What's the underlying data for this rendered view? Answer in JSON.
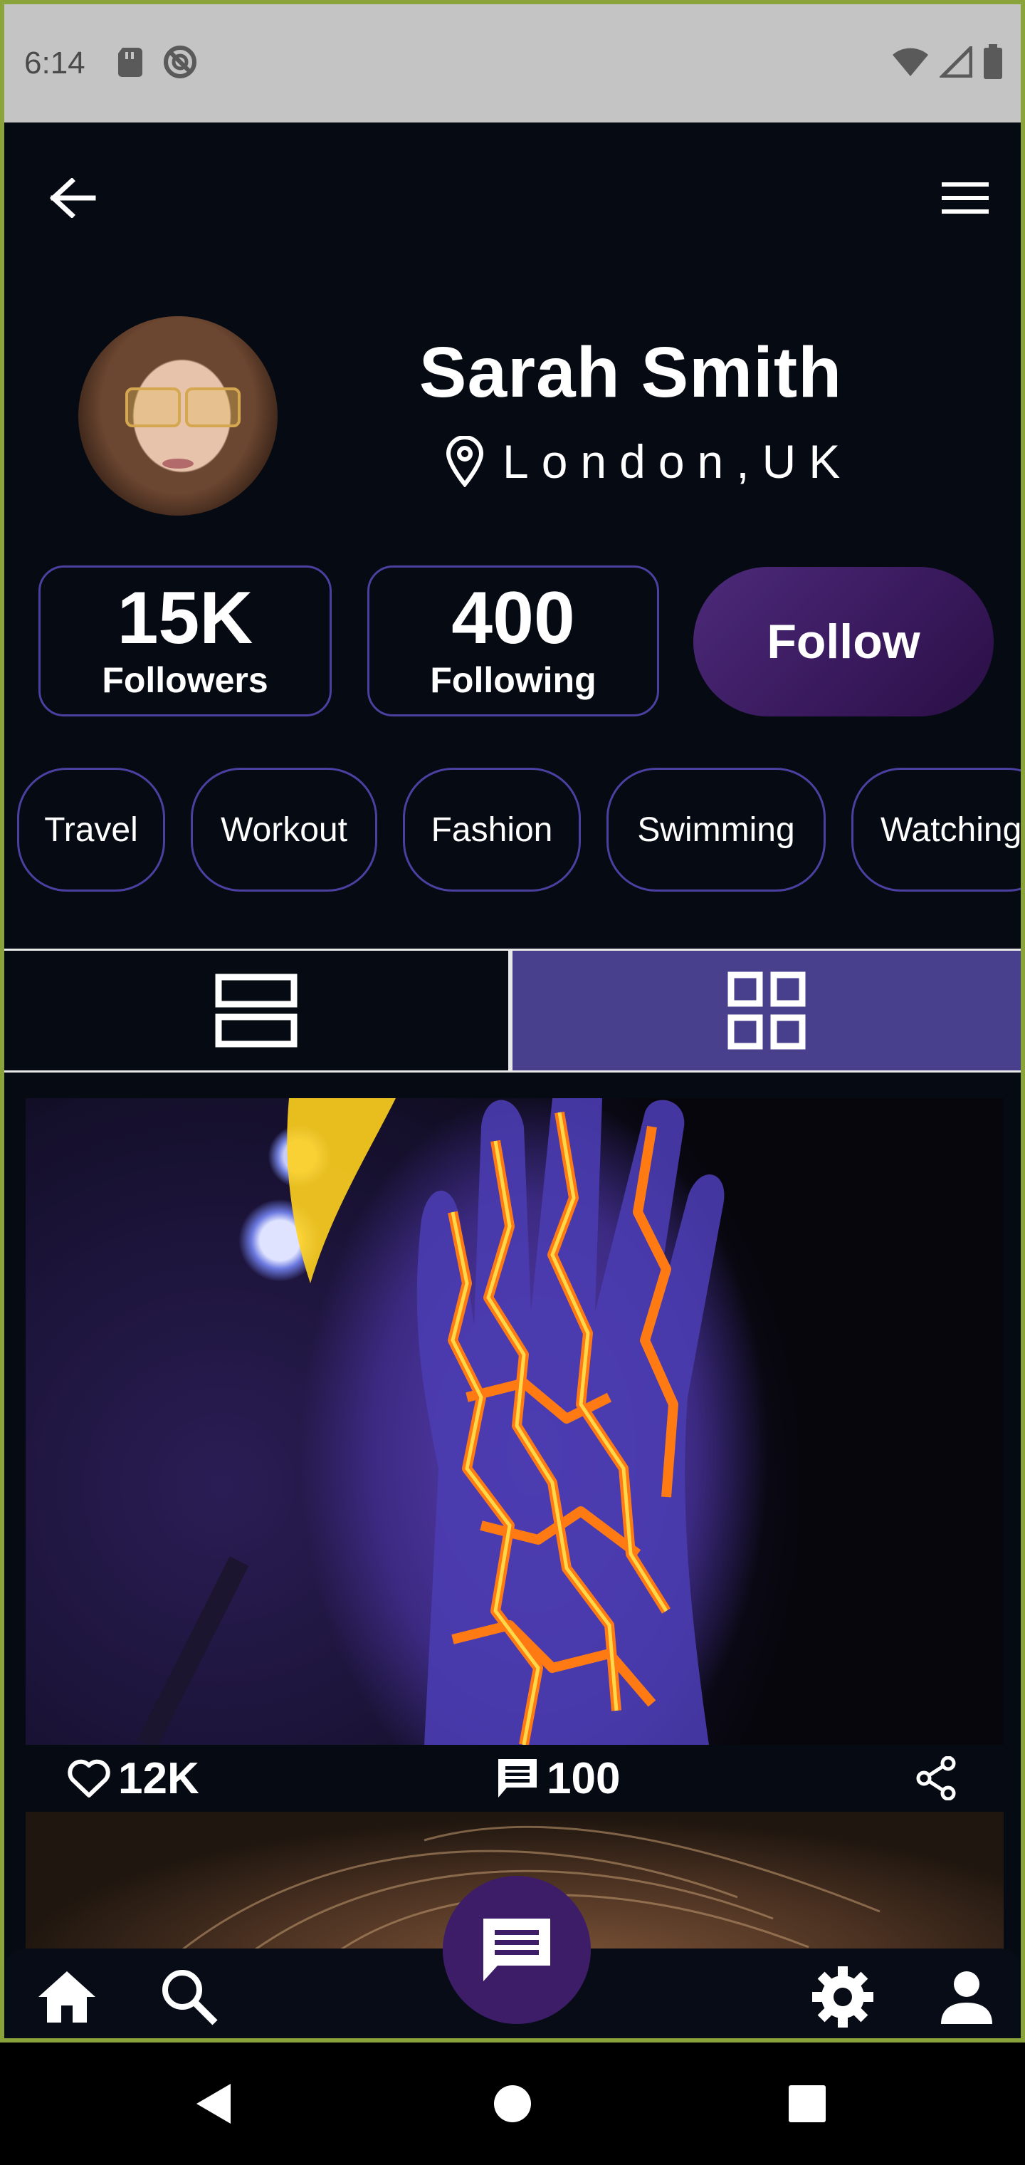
{
  "status_bar": {
    "time": "6:14",
    "left_icons": [
      "sd-card-icon",
      "do-not-disturb-icon"
    ],
    "right_icons": [
      "wifi-icon",
      "signal-icon",
      "battery-icon"
    ]
  },
  "app_bar": {
    "back_icon": "arrow-back-icon",
    "menu_icon": "hamburger-menu-icon"
  },
  "profile": {
    "name": "Sarah Smith",
    "location": "London,UK",
    "location_icon": "map-pin-icon"
  },
  "stats": {
    "followers_value": "15K",
    "followers_label": "Followers",
    "following_value": "400",
    "following_label": "Following",
    "follow_label": "Follow"
  },
  "interests": [
    {
      "label": "Travel"
    },
    {
      "label": "Workout"
    },
    {
      "label": "Fashion"
    },
    {
      "label": "Swimming"
    },
    {
      "label": "Watching"
    }
  ],
  "view_toggle": {
    "list_icon": "list-view-icon",
    "grid_icon": "grid-view-icon",
    "active": "grid"
  },
  "post": {
    "likes": "12K",
    "comments": "100",
    "like_icon": "heart-icon",
    "comment_icon": "comment-icon",
    "share_icon": "share-icon"
  },
  "bottom_nav": {
    "items": [
      "home-icon",
      "search-icon",
      "settings-icon",
      "profile-icon"
    ],
    "fab_icon": "chat-icon"
  },
  "colors": {
    "background": "#060a12",
    "accent": "#483f8d",
    "border": "#4b3fa0",
    "follow_button": "#3e1d68"
  }
}
